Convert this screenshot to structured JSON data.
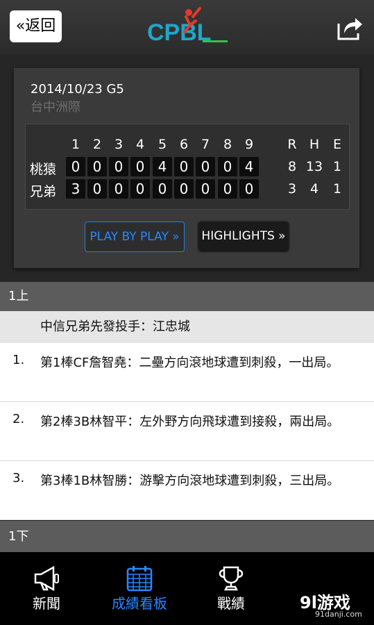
{
  "header": {
    "back_label": "«返回",
    "logo_text": "CPBL"
  },
  "game": {
    "date_label": "2014/10/23 G5",
    "venue": "台中洲際",
    "innings": [
      "1",
      "2",
      "3",
      "4",
      "5",
      "6",
      "7",
      "8",
      "9"
    ],
    "rhe_headers": [
      "R",
      "H",
      "E"
    ],
    "teams": [
      {
        "name": "桃猿",
        "scores": [
          "0",
          "0",
          "0",
          "0",
          "4",
          "0",
          "0",
          "0",
          "4"
        ],
        "rhe": [
          "8",
          "13",
          "1"
        ]
      },
      {
        "name": "兄弟",
        "scores": [
          "3",
          "0",
          "0",
          "0",
          "0",
          "0",
          "0",
          "0",
          "0"
        ],
        "rhe": [
          "3",
          "4",
          "1"
        ]
      }
    ],
    "play_by_play_label": "PLAY BY PLAY »",
    "highlights_label": "HIGHLIGHTS »"
  },
  "plays": {
    "inning_top": "1上",
    "pitcher_note": "中信兄弟先發投手：江忠城",
    "items": [
      {
        "num": "1.",
        "text": "第1棒CF詹智堯：二壘方向滾地球遭到刺殺，一出局。"
      },
      {
        "num": "2.",
        "text": "第2棒3B林智平：左外野方向飛球遭到接殺，兩出局。"
      },
      {
        "num": "3.",
        "text": "第3棒1B林智勝：游擊方向滾地球遭到刺殺，三出局。"
      }
    ],
    "inning_bottom": "1下"
  },
  "nav": {
    "items": [
      {
        "label": "新聞",
        "icon": "megaphone-icon"
      },
      {
        "label": "成績看板",
        "icon": "calendar-icon"
      },
      {
        "label": "戰績",
        "icon": "trophy-icon"
      }
    ]
  },
  "watermark": {
    "main": "9l游戏",
    "sub": "91danji.com"
  },
  "colors": {
    "accent": "#2a87ff",
    "header_bg": "#2b2b2b"
  }
}
